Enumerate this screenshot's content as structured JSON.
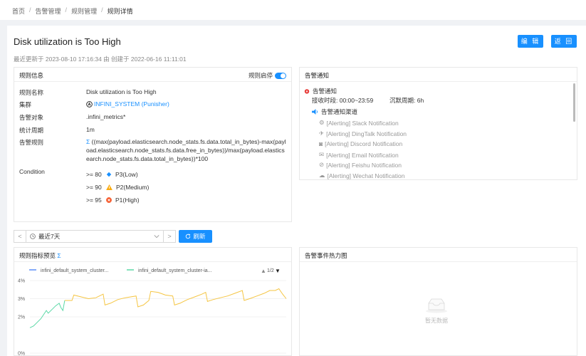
{
  "breadcrumb": {
    "home": "首页",
    "alert_mgmt": "告警管理",
    "rule_mgmt": "规则管理",
    "current": "规则详情",
    "sep": "/"
  },
  "header": {
    "title": "Disk utilization is Too High",
    "subtitle": "最近更新于 2023-08-10 17:16:34 由 创建于 2022-06-16 11:11:01",
    "edit_label": "编 辑",
    "back_label": "返 回"
  },
  "rule_info": {
    "heading": "规则信息",
    "toggle_label": "规则启停",
    "enabled": true,
    "fields": {
      "name_label": "规则名称",
      "name_value": "Disk utilization is Too High",
      "cluster_label": "集群",
      "cluster_value": "INFINI_SYSTEM (Punisher)",
      "target_label": "告警对象",
      "target_value": ".infini_metrics*",
      "period_label": "统计周期",
      "period_value": "1m",
      "rule_label": "告警规则",
      "rule_value": "((max(payload.elasticsearch.node_stats.fs.data.total_in_bytes)-max(payload.elasticsearch.node_stats.fs.data.free_in_bytes))/max(payload.elasticsearch.node_stats.fs.data.total_in_bytes))*100",
      "condition_label": "Condition"
    },
    "conditions": [
      {
        "op": ">= 80",
        "level": "P3(Low)",
        "color": "#1890ff",
        "icon": "info-icon"
      },
      {
        "op": ">= 90",
        "level": "P2(Medium)",
        "color": "#faad14",
        "icon": "warning-icon"
      },
      {
        "op": ">= 95",
        "level": "P1(High)",
        "color": "#f5501e",
        "icon": "error-icon"
      }
    ]
  },
  "notification": {
    "heading": "告警通知",
    "title": "告警通知",
    "receive_time": "接收时段: 00:00~23:59",
    "silence": "沉默周期: 6h",
    "channels_title": "告警通知渠道",
    "channels": [
      {
        "label": "[Alerting] Slack Notification",
        "icon": "slack-icon"
      },
      {
        "label": "[Alerting] DingTalk Notification",
        "icon": "dingtalk-icon"
      },
      {
        "label": "[Alerting] Discord Notification",
        "icon": "discord-icon"
      },
      {
        "label": "[Alerting] Email Notification",
        "icon": "email-icon"
      },
      {
        "label": "[Alerting] Feishu Notification",
        "icon": "feishu-icon"
      },
      {
        "label": "[Alerting] Wechat Notification",
        "icon": "wechat-icon"
      }
    ]
  },
  "time_picker": {
    "prev": "<",
    "next": ">",
    "value": "最近7天",
    "refresh_label": "刷新"
  },
  "preview": {
    "heading": "规则指标预览",
    "pager": "1/2"
  },
  "heatmap": {
    "heading": "告警事件热力图",
    "empty": "暂无数据"
  },
  "chart_data": {
    "type": "line",
    "series": [
      {
        "name": "infini_default_system_cluster...",
        "color": "#5b8ff9"
      },
      {
        "name": "infini_default_system_cluster-ia...",
        "color": "#5ad8a6"
      }
    ],
    "ylim": [
      0,
      4
    ],
    "yticks": [
      "4%",
      "3%",
      "2%",
      "0%"
    ],
    "line_points": [
      [
        0,
        1.4
      ],
      [
        2,
        1.5
      ],
      [
        4,
        1.7
      ],
      [
        6,
        1.9
      ],
      [
        8,
        2.2
      ],
      [
        9,
        2.35
      ],
      [
        10,
        2.2
      ],
      [
        11,
        2.3
      ],
      [
        13,
        2.5
      ],
      [
        14,
        2.6
      ],
      [
        16,
        2.75
      ],
      [
        17,
        2.5
      ],
      [
        18,
        2.35
      ],
      [
        19,
        2.9
      ],
      [
        23,
        2.9
      ],
      [
        24,
        3.2
      ],
      [
        28,
        3.1
      ],
      [
        32,
        3.0
      ],
      [
        36,
        3.05
      ],
      [
        40,
        3.25
      ],
      [
        41,
        2.65
      ],
      [
        44,
        2.75
      ],
      [
        48,
        2.95
      ],
      [
        52,
        3.05
      ],
      [
        58,
        3.15
      ],
      [
        59,
        2.55
      ],
      [
        62,
        2.65
      ],
      [
        65,
        2.9
      ],
      [
        66,
        3.4
      ],
      [
        70,
        3.35
      ],
      [
        74,
        3.2
      ],
      [
        78,
        3.15
      ],
      [
        79,
        2.65
      ],
      [
        82,
        2.75
      ],
      [
        86,
        2.95
      ],
      [
        90,
        3.1
      ],
      [
        94,
        3.25
      ],
      [
        96,
        3.35
      ],
      [
        97,
        2.85
      ],
      [
        100,
        2.95
      ],
      [
        104,
        3.05
      ],
      [
        108,
        3.15
      ],
      [
        112,
        3.3
      ],
      [
        116,
        3.45
      ],
      [
        117,
        2.9
      ],
      [
        120,
        3.0
      ],
      [
        124,
        3.15
      ],
      [
        128,
        3.3
      ],
      [
        131,
        3.45
      ],
      [
        134,
        3.45
      ],
      [
        136,
        3.55
      ],
      [
        138,
        3.25
      ],
      [
        140,
        3.0
      ]
    ],
    "green_until": 19,
    "x_max": 140
  }
}
